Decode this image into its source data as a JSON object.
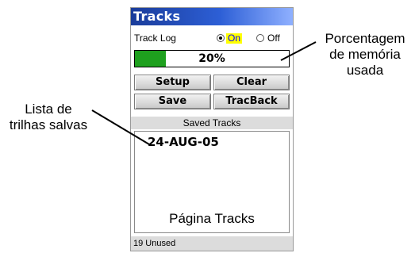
{
  "window": {
    "title": "Tracks"
  },
  "track_log": {
    "label": "Track Log",
    "options": [
      {
        "label": "On",
        "selected": true
      },
      {
        "label": "Off",
        "selected": false
      }
    ]
  },
  "memory": {
    "percent_text": "20%",
    "fill_fraction": 0.2,
    "fill_color": "#1ea01e"
  },
  "buttons": {
    "setup": "Setup",
    "clear": "Clear",
    "save": "Save",
    "tracback": "TracBack"
  },
  "saved_tracks": {
    "header": "Saved Tracks",
    "items": [
      "24-AUG-05"
    ],
    "unused": "19 Unused"
  },
  "annotations": {
    "memory_callout": [
      "Porcentagem",
      "de memória",
      "usada"
    ],
    "list_callout": [
      "Lista de",
      "trilhas salvas"
    ],
    "page_label": "Página Tracks"
  },
  "colors": {
    "title_bar": "#1a3c9a",
    "highlight": "#ffff00",
    "accent": "#0000ff"
  }
}
